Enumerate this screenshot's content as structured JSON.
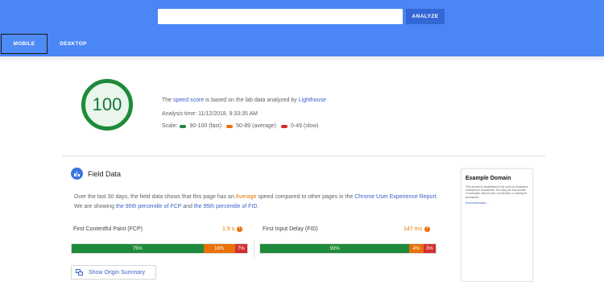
{
  "header": {
    "url_placeholder": "",
    "analyze_label": "ANALYZE",
    "tabs": [
      {
        "label": "MOBILE",
        "active": true
      },
      {
        "label": "DESKTOP",
        "active": false
      }
    ],
    "colors": {
      "bar": "#4a86f5",
      "button": "#3367d6"
    }
  },
  "score": {
    "value": "100",
    "fraction": 1.0,
    "color": "#0e7a34",
    "summary": {
      "the": "The",
      "speed_score": "speed score",
      "middle": "is based on the lab data analyzed by",
      "lighthouse": "Lighthouse",
      "analysis_time": "Analysis time: 11/12/2018, 9:33:35 AM",
      "scale_label": "Scale:",
      "scale": [
        {
          "label": "90-100 (fast)",
          "color": "#1e8a3b"
        },
        {
          "label": "50-89 (average)",
          "color": "#e8710a"
        },
        {
          "label": "0-49 (slow)",
          "color": "#d32f2f"
        }
      ]
    }
  },
  "field_data": {
    "title": "Field Data",
    "desc": {
      "p1": "Over the last 30 days, the field data shows that this page has an",
      "average": "Average",
      "p2": "speed compared to other pages in the",
      "chrome_report": "Chrome User Experience Report",
      "p3": ". We are showing",
      "fcp_pct": "the 90th percentile of FCP",
      "and": "and",
      "fid_pct": "the 95th percentile of FID",
      "end": "."
    },
    "metrics": [
      {
        "label": "First Contentful Paint (FCP)",
        "value": "1.9 s",
        "distribution": [
          {
            "pct": "75%",
            "fraction": 0.75,
            "kind": "g"
          },
          {
            "pct": "18%",
            "fraction": 0.18,
            "kind": "o"
          },
          {
            "pct": "7%",
            "fraction": 0.07,
            "kind": "r"
          }
        ]
      },
      {
        "label": "First Input Delay (FID)",
        "value": "147 ms",
        "distribution": [
          {
            "pct": "93%",
            "fraction": 0.85,
            "kind": "g"
          },
          {
            "pct": "4%",
            "fraction": 0.08,
            "kind": "o"
          },
          {
            "pct": "3%",
            "fraction": 0.07,
            "kind": "r"
          }
        ]
      }
    ],
    "origin_button": "Show Origin Summary"
  },
  "thumbnail": {
    "title": "Example Domain",
    "body": "This domain is established to be used for illustrative examples in documents. You may use this domain in examples without prior coordination or asking for permission.",
    "link": "More information..."
  }
}
